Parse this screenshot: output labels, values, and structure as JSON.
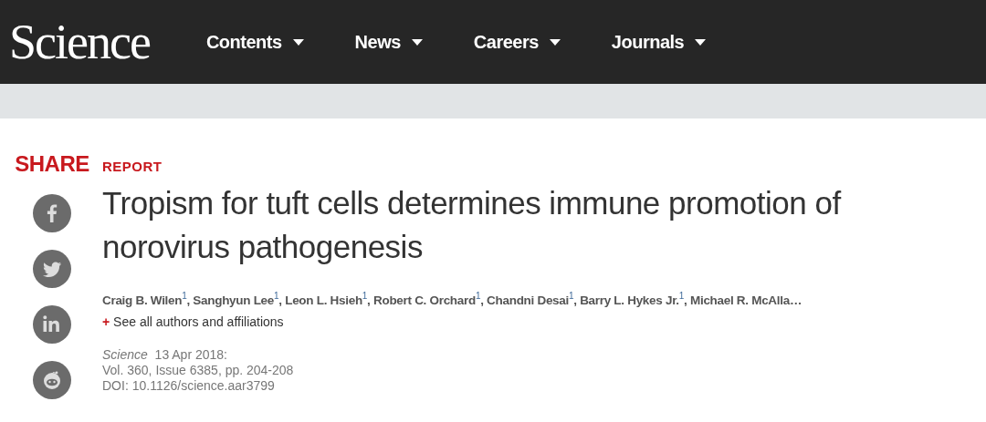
{
  "header": {
    "logo": "Science",
    "nav": [
      {
        "label": "Contents"
      },
      {
        "label": "News"
      },
      {
        "label": "Careers"
      },
      {
        "label": "Journals"
      }
    ]
  },
  "share": {
    "label": "SHARE",
    "buttons": [
      {
        "kind": "facebook"
      },
      {
        "kind": "twitter"
      },
      {
        "kind": "linkedin"
      },
      {
        "kind": "reddit"
      }
    ]
  },
  "article": {
    "type": "REPORT",
    "title": "Tropism for tuft cells determines immune promotion of norovirus pathogenesis",
    "authors": "Craig B. Wilen$^{1}$, Sanghyun Lee$^{1}$, Leon L. Hsieh$^{1}$, Robert C. Orchard$^{1}$, Chandni Desai$^{1}$, Barry L. Hykes Jr.$^{1}$, Michael R. McAlla…",
    "expand": {
      "icon": "+",
      "label": "See all authors and affiliations"
    },
    "journal": "Science",
    "date": "13 Apr 2018:",
    "volume": "Vol. 360, Issue 6385, pp. 204-208",
    "doi": "DOI: 10.1126/science.aar3799"
  }
}
